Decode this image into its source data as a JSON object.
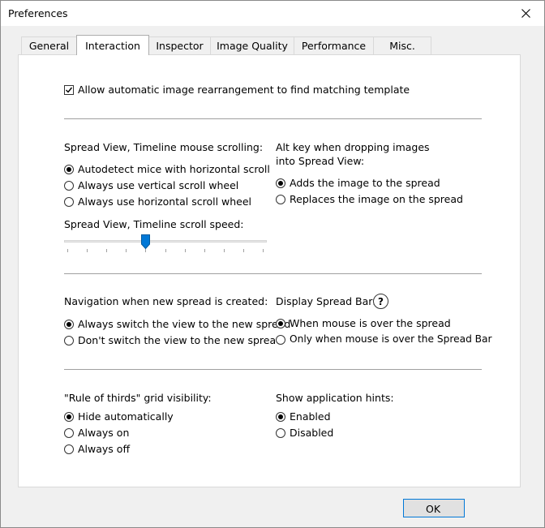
{
  "window": {
    "title": "Preferences"
  },
  "tabs": [
    {
      "label": "General",
      "active": false
    },
    {
      "label": "Interaction",
      "active": true
    },
    {
      "label": "Inspector",
      "active": false
    },
    {
      "label": "Image Quality",
      "active": false
    },
    {
      "label": "Performance",
      "active": false
    },
    {
      "label": "Misc.",
      "active": false
    }
  ],
  "auto_rearrange": {
    "label": "Allow automatic image rearrangement to find matching template",
    "checked": true
  },
  "mouse_scrolling": {
    "title": "Spread View, Timeline mouse scrolling:",
    "options": [
      {
        "label": "Autodetect mice with horizontal scroll",
        "selected": true
      },
      {
        "label": "Always use vertical scroll wheel",
        "selected": false
      },
      {
        "label": "Always use horizontal scroll wheel",
        "selected": false
      }
    ]
  },
  "scroll_speed": {
    "title": "Spread View, Timeline scroll speed:",
    "value": 4,
    "min": 0,
    "max": 10
  },
  "alt_key": {
    "title_line1": "Alt key when dropping images",
    "title_line2": "into Spread View:",
    "options": [
      {
        "label": "Adds the image to the spread",
        "selected": true
      },
      {
        "label": "Replaces the image on the spread",
        "selected": false
      }
    ]
  },
  "navigation": {
    "title": "Navigation when new spread is created:",
    "options": [
      {
        "label": "Always switch the view to the new spread",
        "selected": true
      },
      {
        "label": "Don't switch the view to the new spread",
        "selected": false
      }
    ]
  },
  "spread_bar": {
    "title": "Display Spread Bar:",
    "help": "?",
    "options": [
      {
        "label": "When mouse is over the spread",
        "selected": true
      },
      {
        "label": "Only when mouse is over the Spread Bar",
        "selected": false
      }
    ]
  },
  "rule_of_thirds": {
    "title": "\"Rule of thirds\" grid visibility:",
    "options": [
      {
        "label": "Hide automatically",
        "selected": true
      },
      {
        "label": "Always on",
        "selected": false
      },
      {
        "label": "Always off",
        "selected": false
      }
    ]
  },
  "hints": {
    "title": "Show application hints:",
    "options": [
      {
        "label": "Enabled",
        "selected": true
      },
      {
        "label": "Disabled",
        "selected": false
      }
    ]
  },
  "ok_button": {
    "label": "OK"
  }
}
